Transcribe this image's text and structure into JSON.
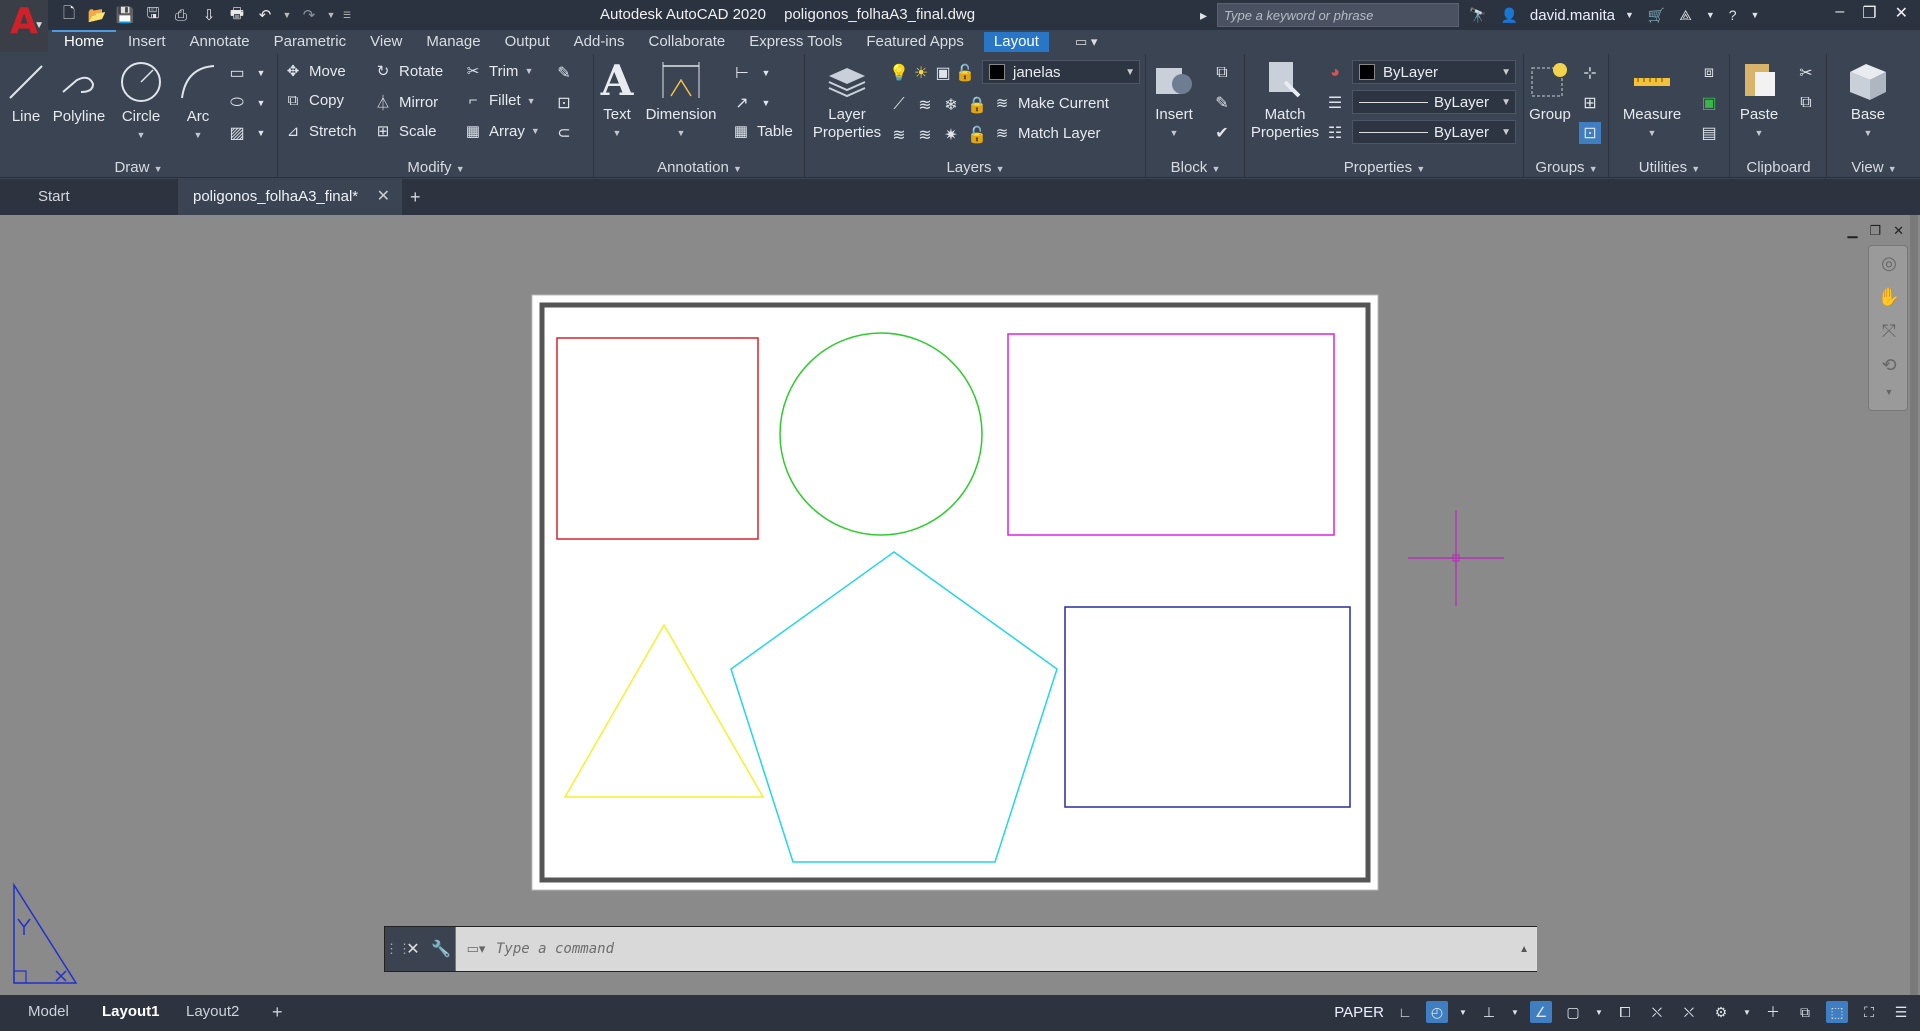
{
  "window": {
    "app_name": "Autodesk AutoCAD 2020",
    "file_name": "poligonos_folhaA3_final.dwg",
    "search_placeholder": "Type a keyword or phrase",
    "user": "david.manita"
  },
  "ribbon_tabs": [
    "Home",
    "Insert",
    "Annotate",
    "Parametric",
    "View",
    "Manage",
    "Output",
    "Add-ins",
    "Collaborate",
    "Express Tools",
    "Featured Apps",
    "Layout"
  ],
  "draw": {
    "title": "Draw",
    "line": "Line",
    "polyline": "Polyline",
    "circle": "Circle",
    "arc": "Arc"
  },
  "modify": {
    "title": "Modify",
    "move": "Move",
    "rotate": "Rotate",
    "trim": "Trim",
    "copy": "Copy",
    "mirror": "Mirror",
    "fillet": "Fillet",
    "stretch": "Stretch",
    "scale": "Scale",
    "array": "Array"
  },
  "annotation": {
    "title": "Annotation",
    "text": "Text",
    "dimension": "Dimension",
    "table": "Table"
  },
  "layers": {
    "title": "Layers",
    "layer_properties_1": "Layer",
    "layer_properties_2": "Properties",
    "current_layer": "janelas",
    "make_current": "Make Current",
    "match_layer": "Match Layer"
  },
  "block": {
    "title": "Block",
    "insert": "Insert"
  },
  "properties": {
    "title": "Properties",
    "match_1": "Match",
    "match_2": "Properties",
    "color": "ByLayer",
    "lineweight": "ByLayer",
    "linetype": "ByLayer"
  },
  "groups": {
    "title": "Groups",
    "group": "Group"
  },
  "utilities": {
    "title": "Utilities",
    "measure": "Measure"
  },
  "clipboard": {
    "title": "Clipboard",
    "paste": "Paste"
  },
  "view": {
    "title": "View",
    "base": "Base"
  },
  "doc_tabs": {
    "start": "Start",
    "file": "poligonos_folhaA3_final*"
  },
  "command": {
    "placeholder": "Type a command"
  },
  "layout_tabs": [
    "Model",
    "Layout1",
    "Layout2"
  ],
  "status": {
    "space": "PAPER"
  },
  "shape_colors": {
    "square": "#d9232d",
    "circle": "#2ecc2e",
    "rect_top": "#e020e0",
    "triangle": "#f2f230",
    "pentagon": "#22d6e6",
    "rect_bottom": "#2a2aa0",
    "crosshair": "#c020c0",
    "ucs": "#2030d0"
  }
}
